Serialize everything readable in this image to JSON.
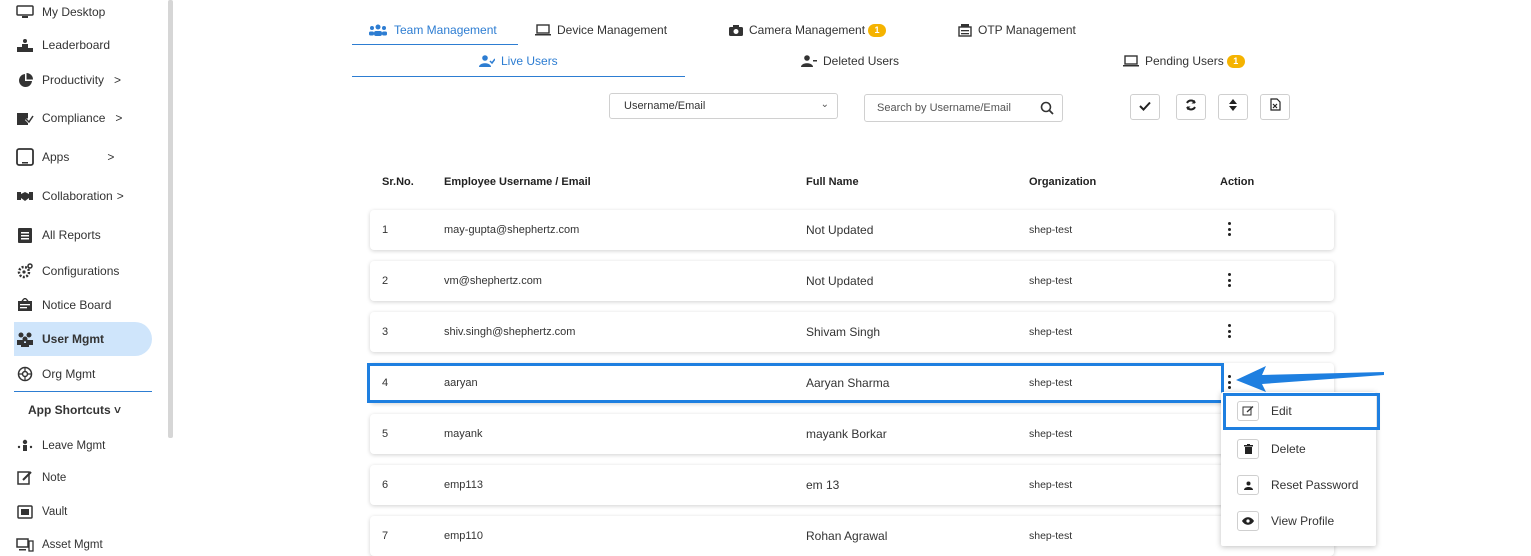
{
  "sidebar": {
    "items": [
      {
        "label": "My Desktop",
        "icon": "monitor-icon"
      },
      {
        "label": "Leaderboard",
        "icon": "podium-icon"
      },
      {
        "label": "Productivity",
        "icon": "pie-chart-icon",
        "chevron": ">"
      },
      {
        "label": "Compliance",
        "icon": "compliance-icon",
        "chevron": ">"
      },
      {
        "label": "Apps",
        "icon": "tablet-icon",
        "chevron": ">"
      },
      {
        "label": "Collaboration",
        "icon": "handshake-icon",
        "chevron": ">"
      },
      {
        "label": "All Reports",
        "icon": "report-icon"
      },
      {
        "label": "Configurations",
        "icon": "gears-icon"
      },
      {
        "label": "Notice Board",
        "icon": "notice-board-icon"
      },
      {
        "label": "User Mgmt",
        "icon": "users-icon",
        "active": true
      },
      {
        "label": "Org Mgmt",
        "icon": "org-icon"
      }
    ],
    "shortcuts_title": "App Shortcuts",
    "shortcuts_chevron": "˅",
    "shortcuts": [
      {
        "label": "Leave Mgmt",
        "icon": "leave-icon"
      },
      {
        "label": "Note",
        "icon": "note-icon"
      },
      {
        "label": "Vault",
        "icon": "vault-icon"
      },
      {
        "label": "Asset Mgmt",
        "icon": "asset-icon"
      }
    ]
  },
  "tabs": {
    "main": [
      {
        "label": "Team Management",
        "active": true
      },
      {
        "label": "Device Management"
      },
      {
        "label": "Camera Management",
        "badge": "1"
      },
      {
        "label": "OTP Management"
      }
    ],
    "sub": [
      {
        "label": "Live Users",
        "active": true
      },
      {
        "label": "Deleted Users"
      },
      {
        "label": "Pending Users",
        "badge": "1"
      }
    ]
  },
  "filters": {
    "select_value": "Username/Email",
    "search_placeholder": "Search by Username/Email"
  },
  "table": {
    "headers": [
      "Sr.No.",
      "Employee Username / Email",
      "Full Name",
      "Organization",
      "Action"
    ],
    "rows": [
      {
        "sr": "1",
        "email": "may-gupta@shephertz.com",
        "name": "Not Updated",
        "org": "shep-test"
      },
      {
        "sr": "2",
        "email": "vm@shephertz.com",
        "name": "Not Updated",
        "org": "shep-test"
      },
      {
        "sr": "3",
        "email": "shiv.singh@shephertz.com",
        "name": "Shivam Singh",
        "org": "shep-test"
      },
      {
        "sr": "4",
        "email": "aaryan",
        "name": "Aaryan Sharma",
        "org": "shep-test"
      },
      {
        "sr": "5",
        "email": "mayank",
        "name": "mayank Borkar",
        "org": "shep-test"
      },
      {
        "sr": "6",
        "email": "emp113",
        "name": "em 13",
        "org": "shep-test"
      },
      {
        "sr": "7",
        "email": "emp110",
        "name": "Rohan Agrawal",
        "org": "shep-test"
      }
    ]
  },
  "action_menu": {
    "items": [
      {
        "label": "Edit",
        "icon": "edit-icon"
      },
      {
        "label": "Delete",
        "icon": "trash-icon"
      },
      {
        "label": "Reset Password",
        "icon": "user-key-icon"
      },
      {
        "label": "View Profile",
        "icon": "eye-icon"
      }
    ]
  },
  "colors": {
    "accent": "#2d7dd2",
    "highlight": "#1e7fe0",
    "active_nav_bg": "#cfe5fb",
    "badge": "#f5b300"
  }
}
